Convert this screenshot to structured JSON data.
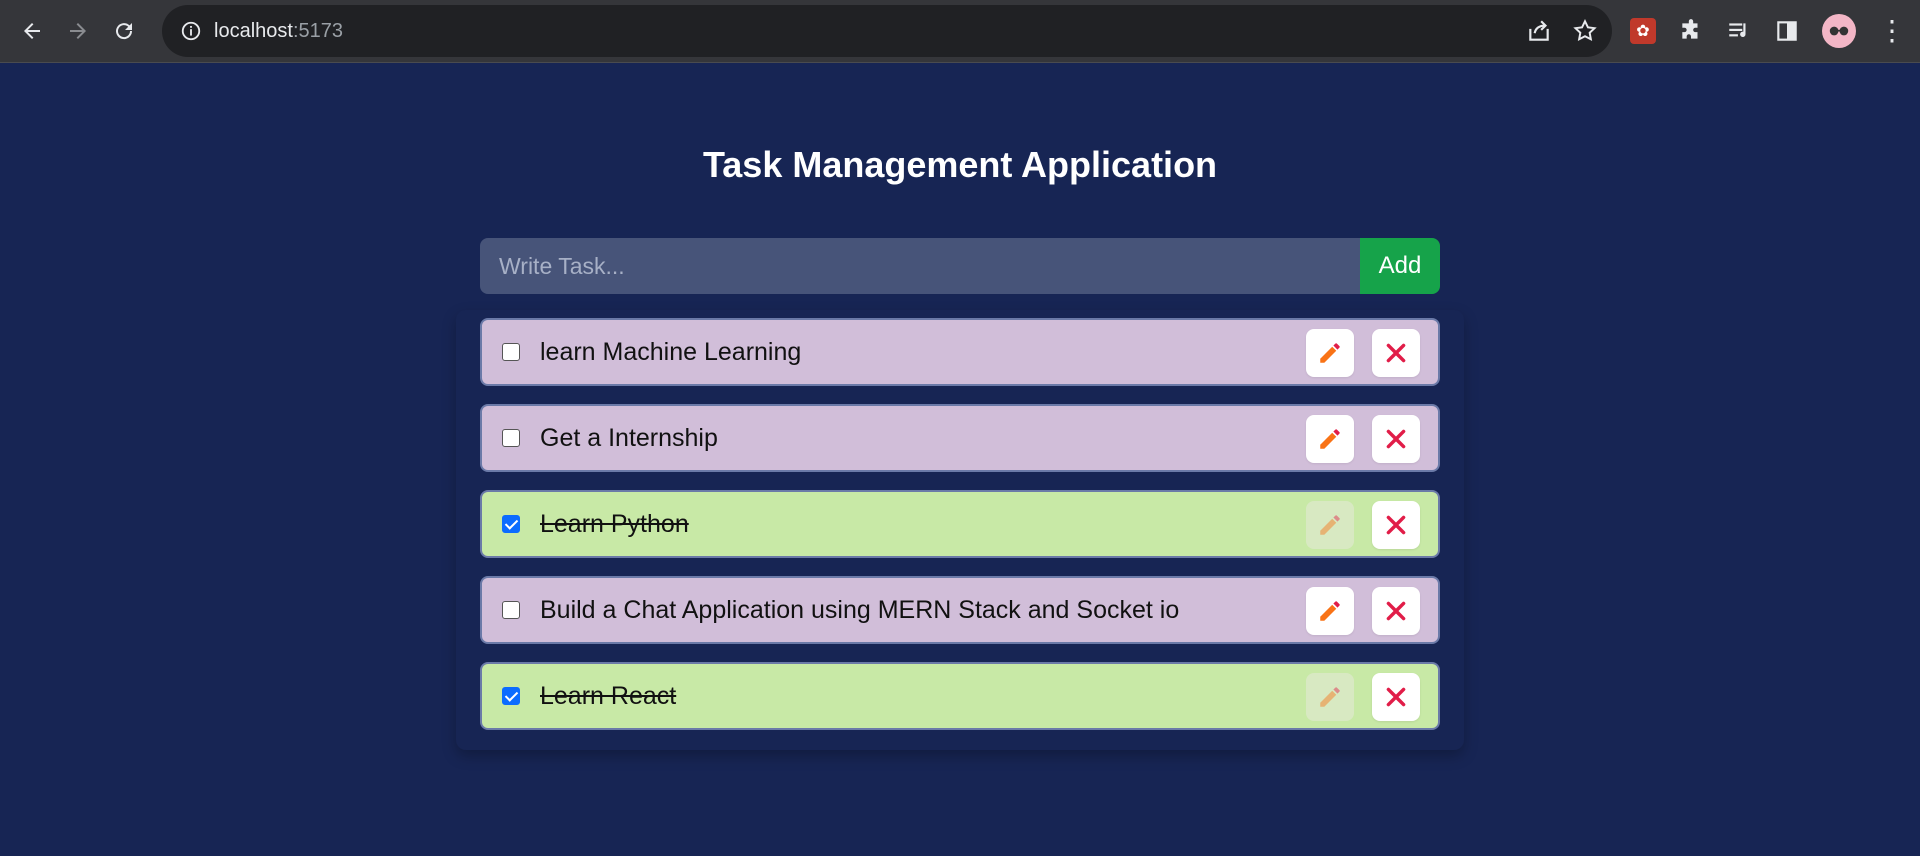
{
  "browser": {
    "url_host": "localhost",
    "url_port": ":5173"
  },
  "app": {
    "title": "Task Management Application",
    "input_placeholder": "Write Task...",
    "add_label": "Add"
  },
  "tasks": [
    {
      "text": "learn Machine Learning",
      "done": false
    },
    {
      "text": "Get a Internship",
      "done": false
    },
    {
      "text": "Learn Python",
      "done": true
    },
    {
      "text": "Build a Chat Application using MERN Stack and Socket io",
      "done": false
    },
    {
      "text": "Learn React",
      "done": true
    }
  ],
  "colors": {
    "background": "#172554",
    "pending_task": "#d1bed9",
    "done_task": "#c8e9a6",
    "add_button": "#16a34a",
    "edit_icon": "#f97316",
    "delete_icon": "#e11d48"
  }
}
